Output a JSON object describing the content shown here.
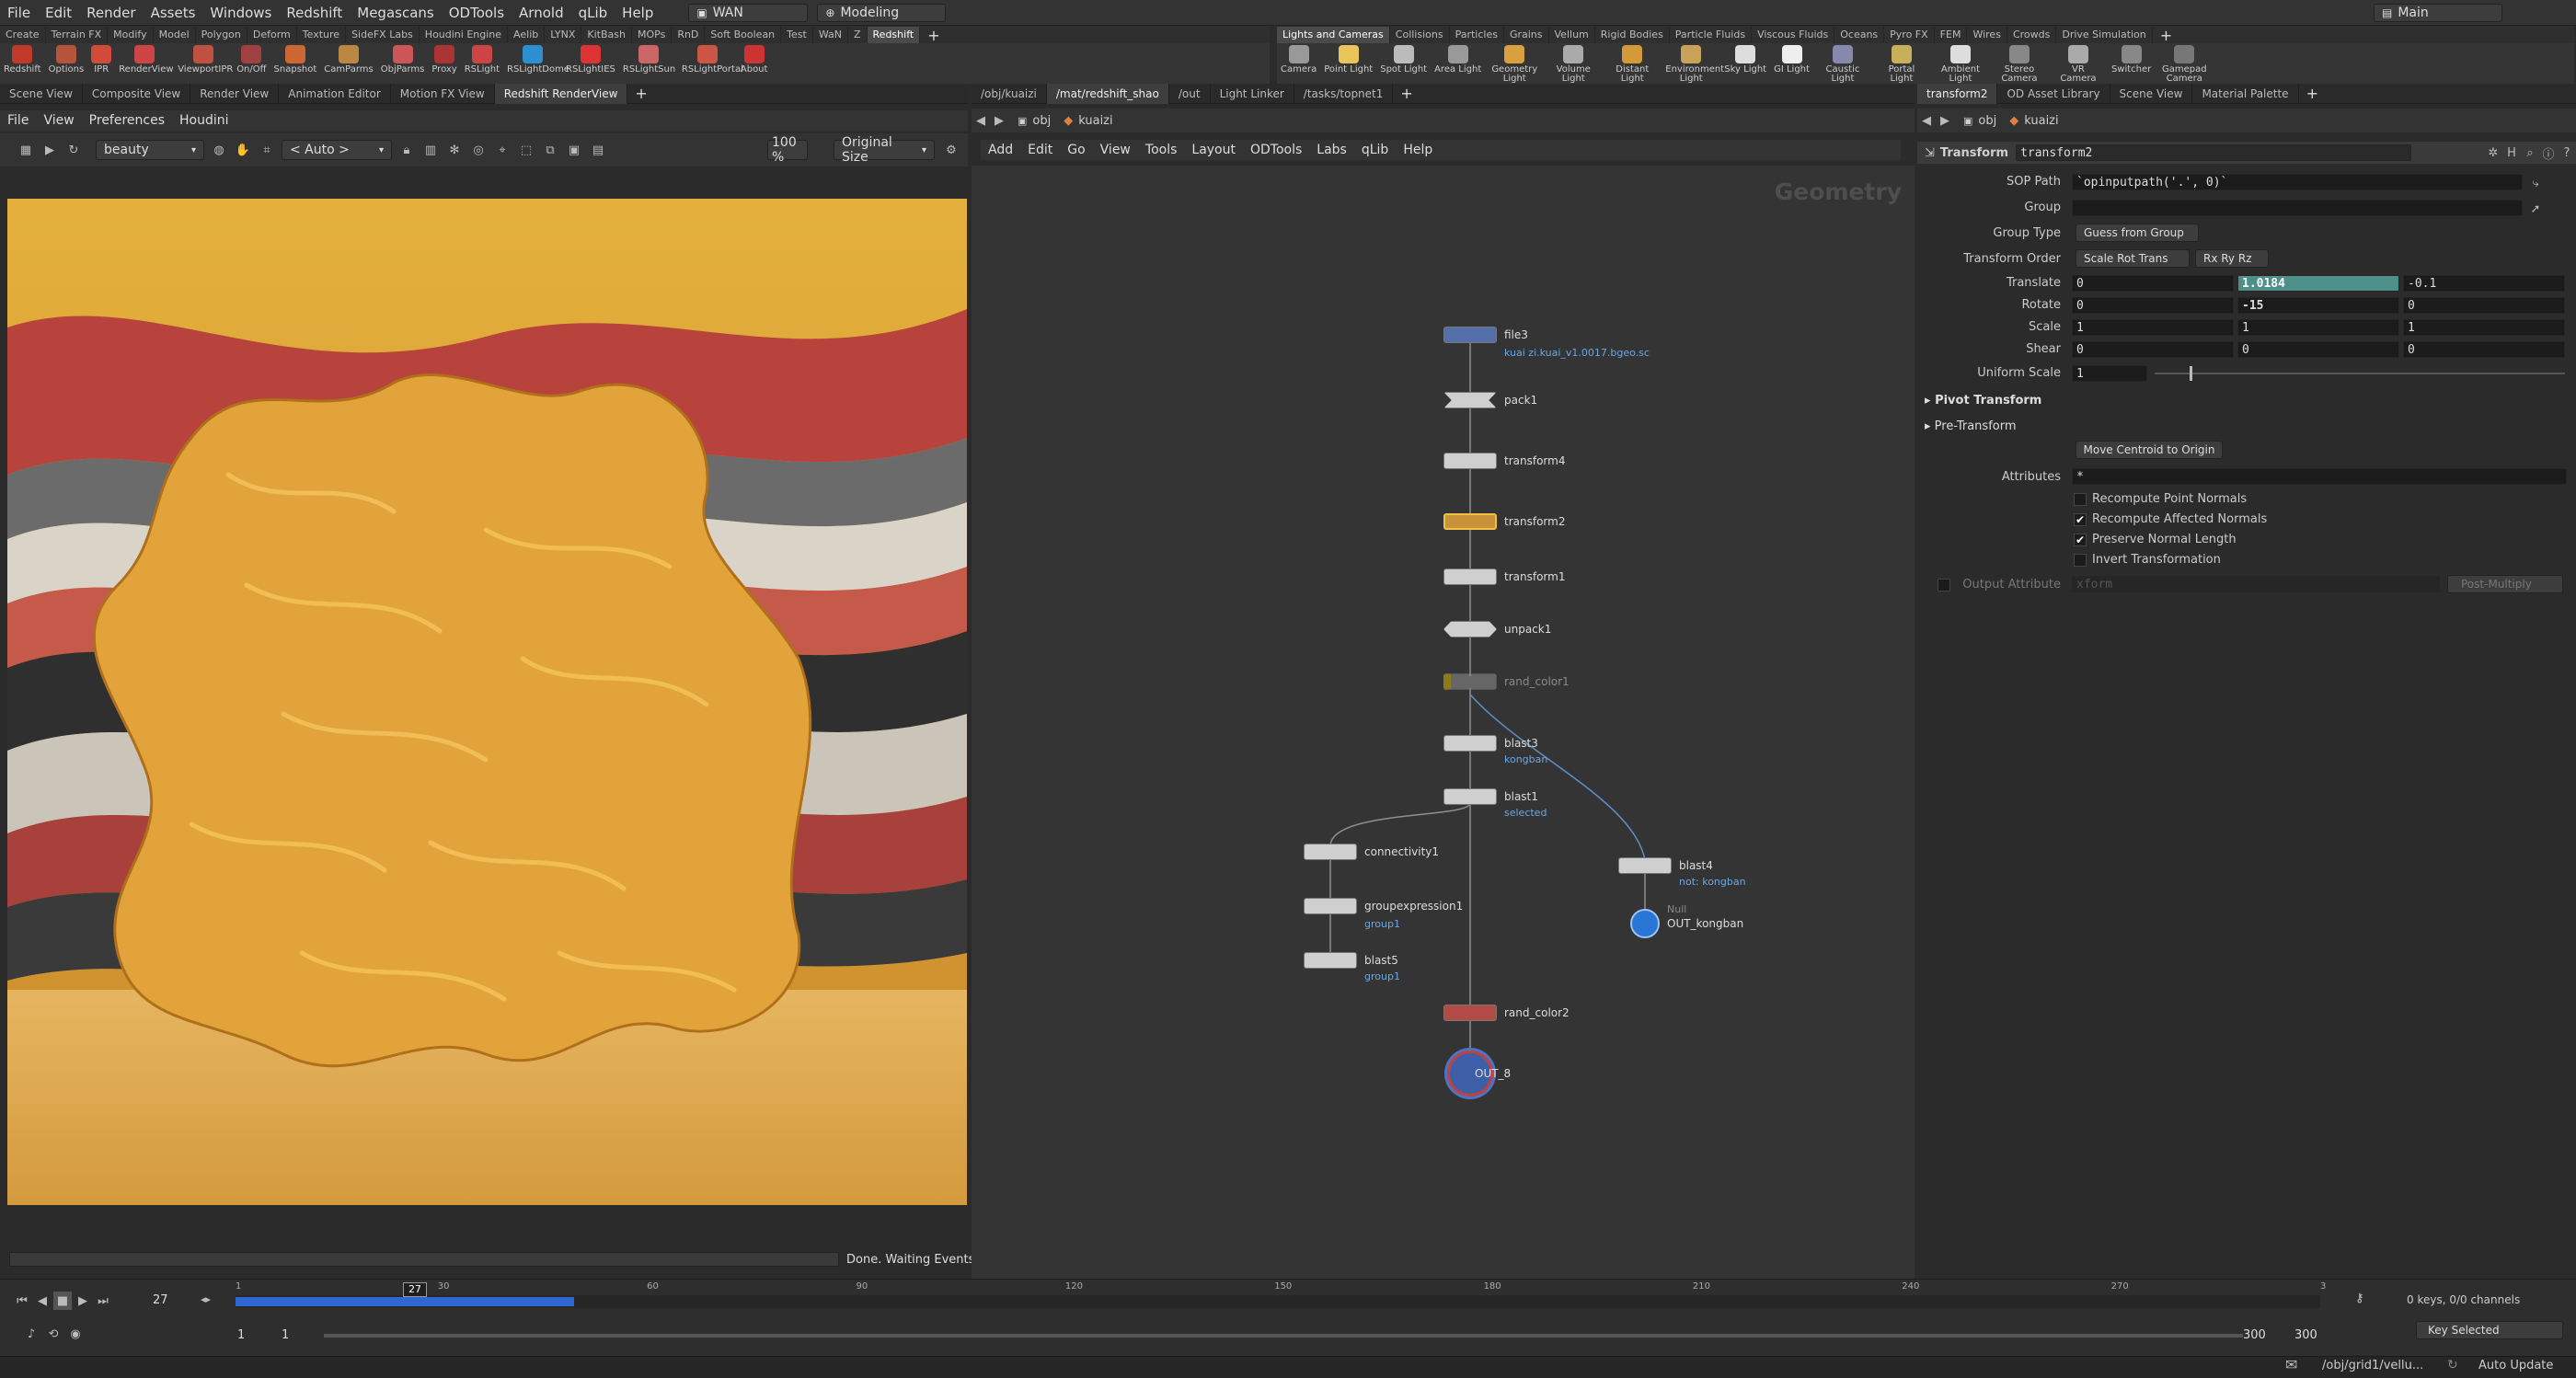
{
  "menubar": {
    "items": [
      "File",
      "Edit",
      "Render",
      "Assets",
      "Windows",
      "Redshift",
      "Megascans",
      "ODTools",
      "Arnold",
      "qLib",
      "Help"
    ],
    "network_combo": "WAN",
    "desktop_combo": "Modeling",
    "main_combo": "Main"
  },
  "shelf_left": {
    "tabs": [
      "Create",
      "Terrain FX",
      "Modify",
      "Model",
      "Polygon",
      "Deform",
      "Texture",
      "SideFX Labs",
      "Houdini Engine",
      "Aelib",
      "LYNX",
      "KitBash",
      "MOPs",
      "RnD",
      "Soft Boolean",
      "Test",
      "WaN",
      "Z",
      "Redshift"
    ],
    "active_tab": "Redshift",
    "tools": [
      "Redshift",
      "Options",
      "IPR",
      "RenderView",
      "ViewportIPR",
      "On/Off",
      "Snapshot",
      "CamParms",
      "ObjParms",
      "Proxy",
      "RSLight",
      "RSLightDome",
      "RSLightIES",
      "RSLightSun",
      "RSLightPortal",
      "About"
    ]
  },
  "shelf_right": {
    "tabs": [
      "Lights and Cameras",
      "Collisions",
      "Particles",
      "Grains",
      "Vellum",
      "Rigid Bodies",
      "Particle Fluids",
      "Viscous Fluids",
      "Oceans",
      "Pyro FX",
      "FEM",
      "Wires",
      "Crowds",
      "Drive Simulation"
    ],
    "active_tab": "Lights and Cameras",
    "tools": [
      "Camera",
      "Point Light",
      "Spot Light",
      "Area Light",
      "Geometry Light",
      "Volume Light",
      "Distant Light",
      "Environment Light",
      "Sky Light",
      "GI Light",
      "Caustic Light",
      "Portal Light",
      "Ambient Light",
      "Stereo Camera",
      "VR Camera",
      "Switcher",
      "Gamepad Camera"
    ]
  },
  "left_pane": {
    "tabs": [
      "Scene View",
      "Composite View",
      "Render View",
      "Animation Editor",
      "Motion FX View",
      "Redshift RenderView"
    ],
    "active_tab": "Redshift RenderView",
    "menu": [
      "File",
      "View",
      "Preferences",
      "Houdini"
    ],
    "aov": "beauty",
    "camera": "< Auto >",
    "zoom": "100 %",
    "size_mode": "Original Size",
    "status": "Done. Waiting Events"
  },
  "middle_pane": {
    "tabs": [
      "/obj/kuaizi",
      "/mat/redshift_shao",
      "/out",
      "Light Linker",
      "/tasks/topnet1"
    ],
    "active_tab": "/mat/redshift_shao",
    "path": [
      "obj",
      "kuaizi"
    ],
    "menu": [
      "Add",
      "Edit",
      "Go",
      "View",
      "Tools",
      "Layout",
      "ODTools",
      "Labs",
      "qLib",
      "Help"
    ],
    "context_label": "Geometry",
    "nodes": [
      {
        "name": "file3",
        "sub": "kuai zi.kuai_v1.0017.bgeo.sc"
      },
      {
        "name": "pack1",
        "sub": ""
      },
      {
        "name": "transform4",
        "sub": ""
      },
      {
        "name": "transform2",
        "sub": ""
      },
      {
        "name": "transform1",
        "sub": ""
      },
      {
        "name": "unpack1",
        "sub": ""
      },
      {
        "name": "rand_color1",
        "sub": ""
      },
      {
        "name": "blast3",
        "sub": "kongban"
      },
      {
        "name": "blast1",
        "sub": "selected"
      },
      {
        "name": "connectivity1",
        "sub": ""
      },
      {
        "name": "groupexpression1",
        "sub": "group1"
      },
      {
        "name": "blast5",
        "sub": "group1"
      },
      {
        "name": "blast4",
        "sub": "not: kongban"
      },
      {
        "name": "OUT_kongban",
        "sub": "Null"
      },
      {
        "name": "rand_color2",
        "sub": ""
      },
      {
        "name": "OUT_8",
        "sub": ""
      }
    ]
  },
  "right_pane": {
    "tabs": [
      "transform2",
      "OD Asset Library",
      "Scene View",
      "Material Palette"
    ],
    "active_tab": "transform2",
    "path": [
      "obj",
      "kuaizi"
    ],
    "node_type": "Transform",
    "node_name": "transform2",
    "parms": {
      "sop_path_label": "SOP Path",
      "sop_path": "`opinputpath('.', 0)`",
      "group_label": "Group",
      "group": "",
      "group_type_label": "Group Type",
      "group_type": "Guess from Group",
      "xform_order_label": "Transform Order",
      "xform_order": "Scale Rot Trans",
      "rot_order": "Rx Ry Rz",
      "translate_label": "Translate",
      "translate": [
        "0",
        "1.0184",
        "-0.1"
      ],
      "rotate_label": "Rotate",
      "rotate": [
        "0",
        "-15",
        "0"
      ],
      "scale_label": "Scale",
      "scale": [
        "1",
        "1",
        "1"
      ],
      "shear_label": "Shear",
      "shear": [
        "0",
        "0",
        "0"
      ],
      "uniform_scale_label": "Uniform Scale",
      "uniform_scale": "1",
      "pivot_transform": "Pivot Transform",
      "pre_transform": "Pre-Transform",
      "move_centroid": "Move Centroid to Origin",
      "attributes_label": "Attributes",
      "attributes": "*",
      "recompute_point_normals": "Recompute Point Normals",
      "recompute_affected_normals": "Recompute Affected Normals",
      "preserve_normal_length": "Preserve Normal Length",
      "invert_transformation": "Invert Transformation",
      "output_attribute_label": "Output Attribute",
      "output_attribute": "xform",
      "post_multiply": "Post-Multiply"
    }
  },
  "timeline": {
    "current_frame": "27",
    "ticks": [
      "1",
      "30",
      "60",
      "90",
      "120",
      "150",
      "180",
      "210",
      "240",
      "270",
      "3"
    ],
    "range_start": "1",
    "range_start2": "1",
    "range_end": "300",
    "range_end2": "300",
    "keys_info": "0 keys, 0/0 channels",
    "key_mode": "Key Selected",
    "status_path": "/obj/grid1/vellu...",
    "update_mode": "Auto Update"
  }
}
